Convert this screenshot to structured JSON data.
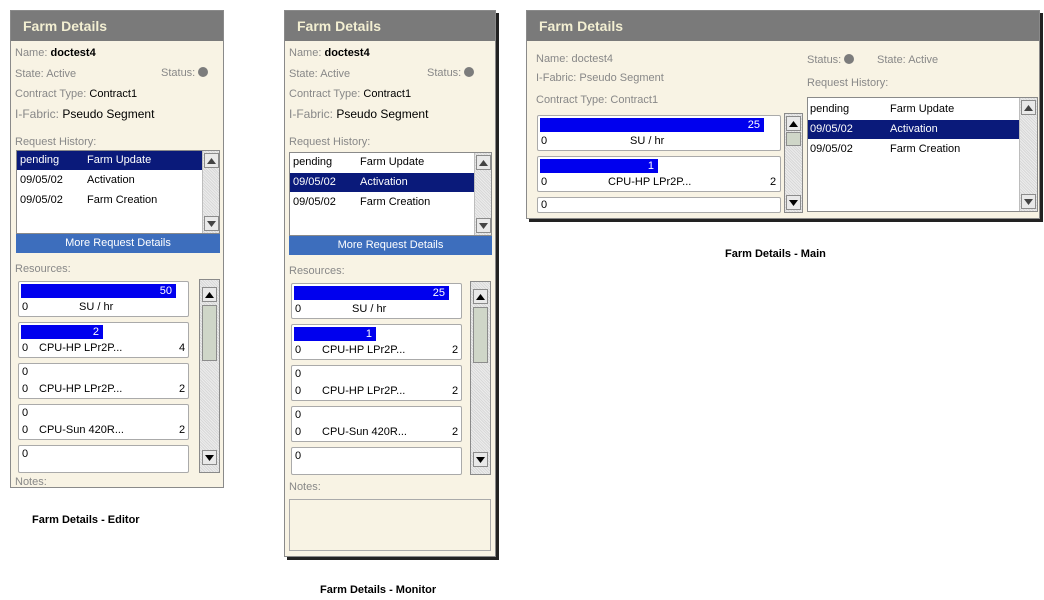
{
  "panels": {
    "editor": {
      "header": "Farm Details",
      "name_label": "Name: ",
      "name_value": "doctest4",
      "state": "State: Active",
      "status_label": "Status:",
      "contract_label": "Contract Type: ",
      "contract_value": "Contract1",
      "fabric_label": "I-Fabric: ",
      "fabric_value": "Pseudo Segment",
      "request_history_label": "Request History:",
      "history": [
        {
          "date": "pending",
          "action": "Farm Update",
          "selected": true
        },
        {
          "date": "09/05/02",
          "action": "Activation",
          "selected": false
        },
        {
          "date": "09/05/02",
          "action": "Farm Creation",
          "selected": false
        }
      ],
      "more_button": "More Request Details",
      "resources_label": "Resources:",
      "resources": [
        {
          "bar_label": "50",
          "fill": 0.95,
          "left": "0",
          "name": "SU / hr",
          "right": ""
        },
        {
          "bar_label": "2",
          "fill": 0.5,
          "left": "0",
          "name": "CPU-HP LPr2P...",
          "right": "4"
        },
        {
          "bar_label": "0",
          "fill": 0,
          "left": "0",
          "name": "CPU-HP LPr2P...",
          "right": "2"
        },
        {
          "bar_label": "0",
          "fill": 0,
          "left": "0",
          "name": "CPU-Sun 420R...",
          "right": "2"
        },
        {
          "bar_label": "0",
          "fill": 0,
          "left": "",
          "name": "",
          "right": ""
        }
      ],
      "notes_label": "Notes:"
    },
    "monitor": {
      "header": "Farm Details",
      "name_label": "Name: ",
      "name_value": "doctest4",
      "state": "State: Active",
      "status_label": "Status:",
      "contract_label": "Contract Type: ",
      "contract_value": "Contract1",
      "fabric_label": "I-Fabric: ",
      "fabric_value": "Pseudo Segment",
      "request_history_label": "Request History:",
      "history": [
        {
          "date": "pending",
          "action": "Farm Update",
          "selected": false
        },
        {
          "date": "09/05/02",
          "action": "Activation",
          "selected": true
        },
        {
          "date": "09/05/02",
          "action": "Farm Creation",
          "selected": false
        }
      ],
      "more_button": "More Request Details",
      "resources_label": "Resources:",
      "resources": [
        {
          "bar_label": "25",
          "fill": 0.95,
          "left": "0",
          "name": "SU / hr",
          "right": ""
        },
        {
          "bar_label": "1",
          "fill": 0.5,
          "left": "0",
          "name": "CPU-HP LPr2P...",
          "right": "2"
        },
        {
          "bar_label": "0",
          "fill": 0,
          "left": "0",
          "name": "CPU-HP LPr2P...",
          "right": "2"
        },
        {
          "bar_label": "0",
          "fill": 0,
          "left": "0",
          "name": "CPU-Sun 420R...",
          "right": "2"
        },
        {
          "bar_label": "0",
          "fill": 0,
          "left": "",
          "name": "",
          "right": ""
        }
      ],
      "notes_label": "Notes:"
    },
    "main": {
      "header": "Farm Details",
      "name": "Name: doctest4",
      "fabric": "I-Fabric: Pseudo Segment",
      "contract": "Contract Type: Contract1",
      "status_label": "Status:",
      "state": "State: Active",
      "request_history_label": "Request History:",
      "history": [
        {
          "date": "pending",
          "action": "Farm Update",
          "selected": false
        },
        {
          "date": "09/05/02",
          "action": "Activation",
          "selected": true
        },
        {
          "date": "09/05/02",
          "action": "Farm Creation",
          "selected": false
        }
      ],
      "resources": [
        {
          "bar_label": "25",
          "fill": 0.95,
          "left": "0",
          "name": "SU / hr",
          "right": ""
        },
        {
          "bar_label": "1",
          "fill": 0.5,
          "left": "0",
          "name": "CPU-HP LPr2P...",
          "right": "2"
        },
        {
          "bar_label": "",
          "fill": 0,
          "left": "0",
          "name": "",
          "right": ""
        }
      ]
    }
  },
  "captions": {
    "editor": "Farm Details - Editor",
    "monitor": "Farm Details - Monitor",
    "main": "Farm Details - Main"
  },
  "colors": {
    "header_bg": "#7a7a7a",
    "header_text": "#f3efd2",
    "panel_bg": "#f8f3e4",
    "selection": "#0a1a7a",
    "bar": "#0000ee",
    "button": "#3d6ebd"
  }
}
